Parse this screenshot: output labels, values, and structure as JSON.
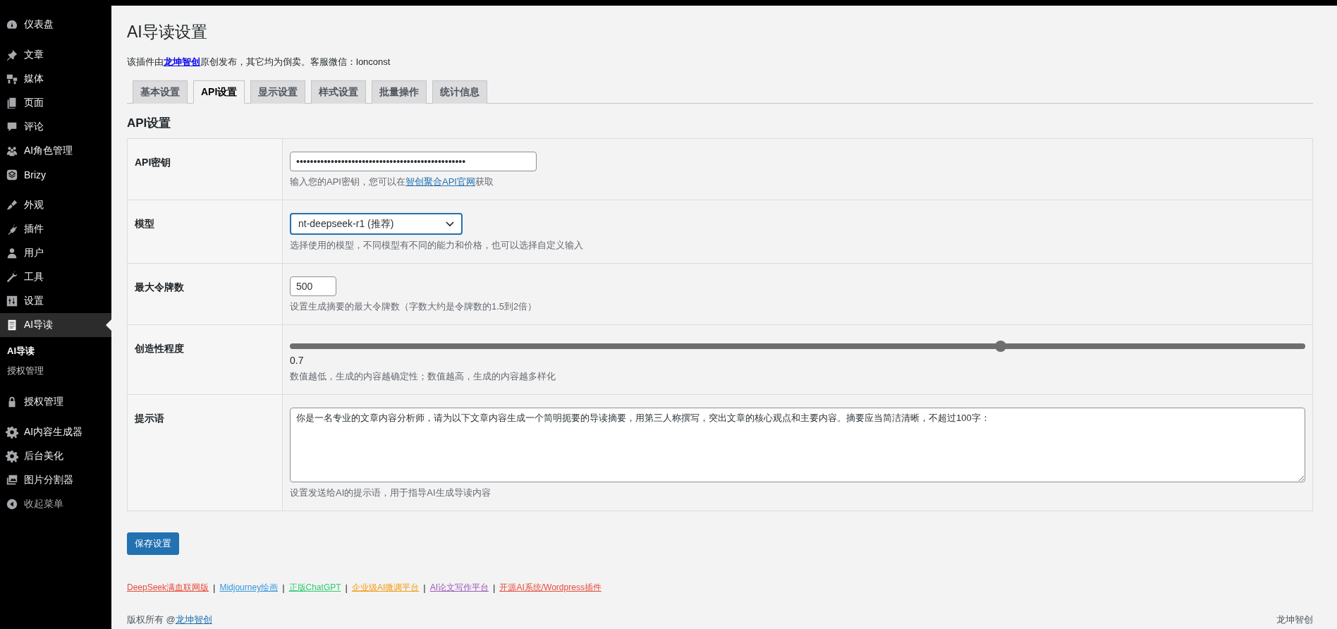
{
  "sidebar": {
    "groups": [
      {
        "items": [
          {
            "kind": "menu",
            "label": "仪表盘",
            "selected": false
          }
        ]
      },
      {
        "items": [
          {
            "kind": "menu",
            "label": "文章",
            "selected": false
          },
          {
            "kind": "menu",
            "label": "媒体",
            "selected": false
          },
          {
            "kind": "menu",
            "label": "页面",
            "selected": false
          },
          {
            "kind": "menu",
            "label": "评论",
            "selected": false
          },
          {
            "kind": "menu",
            "label": "AI角色管理",
            "selected": false
          },
          {
            "kind": "menu",
            "label": "Brizy",
            "selected": false
          }
        ]
      },
      {
        "items": [
          {
            "kind": "menu",
            "label": "外观",
            "selected": false
          },
          {
            "kind": "menu",
            "label": "插件",
            "selected": false
          },
          {
            "kind": "menu",
            "label": "用户",
            "selected": false
          },
          {
            "kind": "menu",
            "label": "工具",
            "selected": false
          },
          {
            "kind": "menu",
            "label": "设置",
            "selected": false
          },
          {
            "kind": "menu",
            "label": "AI导读",
            "selected": true,
            "children": [
              {
                "label": "AI导读",
                "selected": true
              },
              {
                "label": "授权管理",
                "selected": false
              }
            ]
          }
        ]
      },
      {
        "items": [
          {
            "kind": "menu",
            "label": "授权管理",
            "selected": false
          }
        ]
      },
      {
        "items": [
          {
            "kind": "menu",
            "label": "AI内容生成器",
            "selected": false
          },
          {
            "kind": "menu",
            "label": "后台美化",
            "selected": false
          },
          {
            "kind": "menu",
            "label": "图片分割器",
            "selected": false
          },
          {
            "kind": "collapse",
            "label": "收起菜单",
            "selected": false
          }
        ]
      }
    ]
  },
  "page": {
    "title": "AI导读设置",
    "notice": {
      "before": "该插件由",
      "link": "龙坤智创",
      "after": "原创发布，其它均为倒卖。客服微信：lonconst"
    }
  },
  "tabs": [
    {
      "label": "基本设置",
      "selected": false
    },
    {
      "label": "API设置",
      "selected": true
    },
    {
      "label": "显示设置",
      "selected": false
    },
    {
      "label": "样式设置",
      "selected": false
    },
    {
      "label": "批量操作",
      "selected": false
    },
    {
      "label": "统计信息",
      "selected": false
    }
  ],
  "section_title": "API设置",
  "fields": [
    {
      "kind": "secret",
      "label": "API密钥",
      "value": "•••••••••••••••••••••••••••••••••••••••••••••••••",
      "description": {
        "before": "输入您的API密钥，您可以在",
        "link": "智创聚合API官网",
        "after": "获取"
      }
    },
    {
      "kind": "select",
      "label": "模型",
      "value": "nt-deepseek-r1 (推荐)",
      "description": {
        "before": "选择使用的模型，不同模型有不同的能力和价格，也可以选择自定义输入"
      }
    },
    {
      "kind": "number",
      "label": "最大令牌数",
      "value": "500",
      "description": {
        "before": "设置生成摘要的最大令牌数（字数大约是令牌数的1.5到2倍）"
      }
    },
    {
      "kind": "range",
      "label": "创造性程度",
      "level": 0.7,
      "value": "0.7",
      "description": {
        "before": "数值越低，生成的内容越确定性；数值越高，生成的内容越多样化"
      }
    },
    {
      "kind": "textarea",
      "label": "提示语",
      "value": "你是一名专业的文章内容分析师，请为以下文章内容生成一个简明扼要的导读摘要，用第三人称撰写，突出文章的核心观点和主要内容。摘要应当简洁清晰，不超过100字：",
      "description": {
        "before": "设置发送给AI的提示语，用于指导AI生成导读内容"
      }
    }
  ],
  "save_button": "保存设置",
  "links": [
    {
      "label": "DeepSeek满血联网版",
      "color": "#e74c3c"
    },
    {
      "label": "Midjourney绘画",
      "color": "#3498db"
    },
    {
      "label": "正版ChatGPT",
      "color": "#2ecc71"
    },
    {
      "label": "企业级AI微调平台",
      "color": "#f39c12"
    },
    {
      "label": "AI论文写作平台",
      "color": "#9b59b6"
    },
    {
      "label": "开源AI系统/Wordpress插件",
      "color": "#e74c3c"
    }
  ],
  "link_separators": [
    "|",
    "|",
    "|",
    "|",
    "|"
  ],
  "footer": {
    "left_text": "版权所有 @",
    "left_link": "龙坤智创",
    "right_text": "龙坤智创"
  }
}
